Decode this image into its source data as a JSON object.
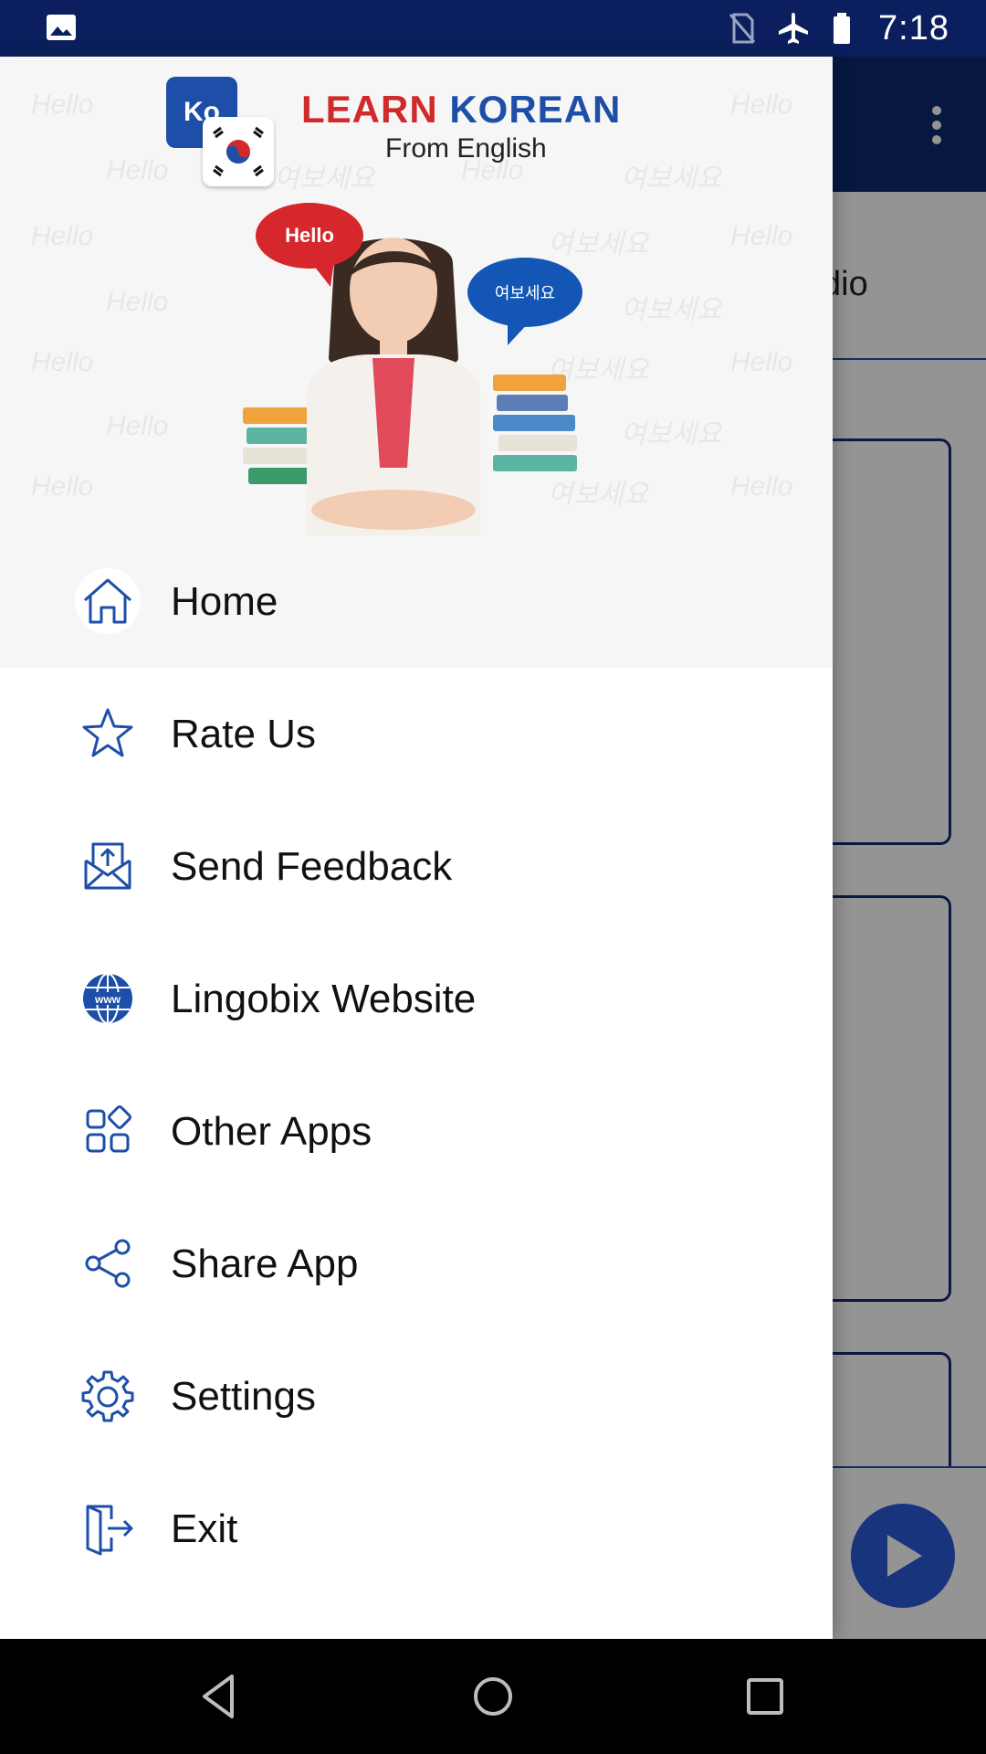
{
  "status_bar": {
    "time": "7:18",
    "left_icon": "image-notification-icon",
    "right_icons": [
      "no-sim-icon",
      "airplane-mode-icon",
      "battery-icon"
    ]
  },
  "background_app": {
    "tab_partial_text": "dio"
  },
  "drawer": {
    "logo": {
      "badge": "Ko",
      "title_learn": "LEARN",
      "title_korean": "KOREAN",
      "subtitle": "From English"
    },
    "bubbles": {
      "hello": "Hello",
      "korean": "여보세요"
    },
    "menu": [
      {
        "label": "Home",
        "icon": "home-icon",
        "active": true
      },
      {
        "label": "Rate Us",
        "icon": "star-icon",
        "active": false
      },
      {
        "label": "Send Feedback",
        "icon": "feedback-icon",
        "active": false
      },
      {
        "label": "Lingobix Website",
        "icon": "globe-icon",
        "active": false
      },
      {
        "label": "Other Apps",
        "icon": "apps-icon",
        "active": false
      },
      {
        "label": "Share App",
        "icon": "share-icon",
        "active": false
      },
      {
        "label": "Settings",
        "icon": "settings-icon",
        "active": false
      },
      {
        "label": "Exit",
        "icon": "exit-icon",
        "active": false
      }
    ]
  },
  "colors": {
    "status_bar": "#0b1f5e",
    "app_bar": "#0b2a6e",
    "accent_blue": "#1e4fa8",
    "accent_red": "#d12a2a",
    "icon_blue": "#1e4fa8"
  }
}
